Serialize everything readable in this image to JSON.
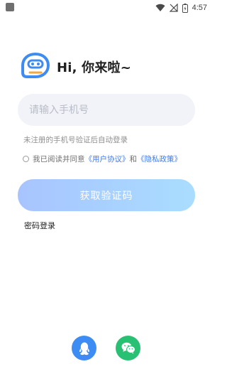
{
  "status_bar": {
    "time": "4:57",
    "icons": [
      "notification-square-icon",
      "wifi-icon",
      "no-signal-icon",
      "battery-charging-icon"
    ]
  },
  "header": {
    "logo": "chat-bot-logo-icon",
    "greeting": "Hi, 你来啦~"
  },
  "form": {
    "phone_placeholder": "请输入手机号",
    "phone_value": "",
    "hint": "未注册的手机号验证后自动登录",
    "agreement": {
      "prefix": "我已阅读并同意",
      "user_agreement": "《用户协议》",
      "and": "和",
      "privacy_policy": "《隐私政策》"
    },
    "get_code_button": "获取验证码",
    "password_login": "密码登录"
  },
  "social_login": [
    {
      "name": "qq",
      "icon": "qq-penguin-icon"
    },
    {
      "name": "wechat",
      "icon": "wechat-icon"
    }
  ],
  "colors": {
    "accent_blue": "#3f7bf2",
    "button_gradient_start": "#a8c4ff",
    "button_gradient_end": "#a9ddff",
    "qq_blue": "#3d8cf3",
    "wechat_green": "#28c073"
  }
}
